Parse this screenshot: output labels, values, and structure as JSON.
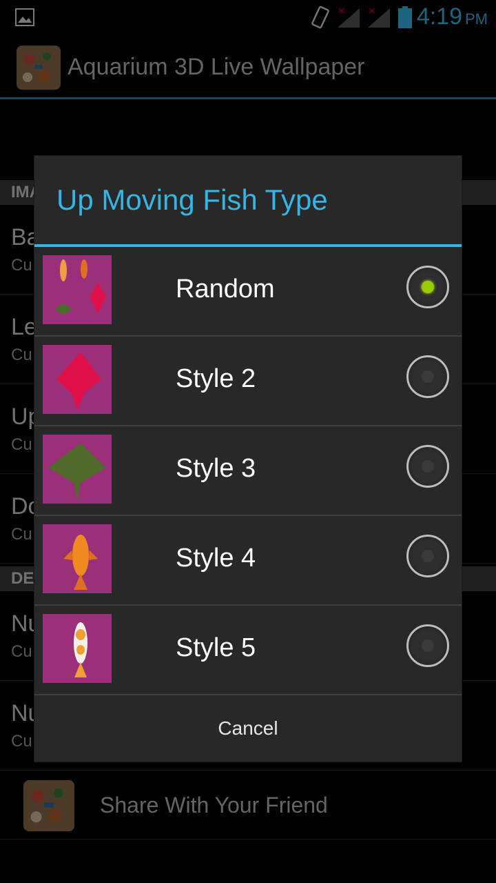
{
  "status_bar": {
    "time": "4:19",
    "ampm": "PM",
    "icons": [
      "image-icon",
      "vibrate-icon",
      "signal-icon",
      "signal-icon",
      "battery-icon"
    ]
  },
  "action_bar": {
    "title": "Aquarium 3D Live Wallpaper"
  },
  "background_list": {
    "sections": [
      {
        "label": "IMA"
      },
      {
        "label": "DE"
      }
    ],
    "items": [
      {
        "title": "Ba",
        "summary": "Cu"
      },
      {
        "title": "Le",
        "summary": "Cu"
      },
      {
        "title": "Up",
        "summary": "Cu"
      },
      {
        "title": "Do",
        "summary": "Cu"
      },
      {
        "title": "Nu",
        "summary": "Cu"
      },
      {
        "title": "Nu",
        "summary": "Cu"
      }
    ],
    "share_label": "Share With Your Friend"
  },
  "dialog": {
    "title": "Up Moving Fish Type",
    "options": [
      {
        "label": "Random",
        "checked": true
      },
      {
        "label": "Style 2",
        "checked": false
      },
      {
        "label": "Style 3",
        "checked": false
      },
      {
        "label": "Style 4",
        "checked": false
      },
      {
        "label": "Style 5",
        "checked": false
      }
    ],
    "cancel_label": "Cancel"
  },
  "colors": {
    "accent": "#33b5e5",
    "radio_checked": "#99cc00",
    "thumb_bg": "#9b2f7a"
  }
}
